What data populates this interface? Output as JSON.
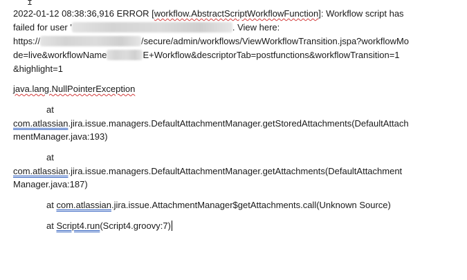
{
  "document": {
    "l1_a": "2022-01-12 08:38:36,916 ERROR [",
    "l1_b": "workflow.AbstractScriptWorkflowFunction",
    "l1_c": "]: Workflow script has",
    "l2_a": "failed for user '",
    "l2_b": ". View here:",
    "l3_a": "https://",
    "l3_b": "/secure/admin/workflows/ViewWorkflowTransition.jspa?workflowMo",
    "l4_a": "de=live&workflowName",
    "l4_b": "E+Workflow&descriptorTab=postfunctions&workflowTransition=1",
    "l5": "&highlight=1",
    "l6": "java.lang.NullPointerException",
    "l7": "at",
    "l8_a": "com.atlassian",
    "l8_b": ".jira.issue.managers.DefaultAttachmentManager.getStoredAttachments(DefaultAttach",
    "l9": "mentManager.java:193)",
    "l10": "at",
    "l11_a": "com.atlassian",
    "l11_b": ".jira.issue.managers.DefaultAttachmentManager.getAttachments(DefaultAttachment",
    "l12": "Manager.java:187)",
    "l13_a": "at ",
    "l13_b": "com.atlassian",
    "l13_c": ".jira.issue.AttachmentManager$getAttachments.call(Unknown Source)",
    "l14_a": "at ",
    "l14_b": "Script4.run",
    "l14_c": "(Script4.groovy:7)"
  },
  "icons": {
    "text_cursor": "i-beam-cursor-icon"
  }
}
